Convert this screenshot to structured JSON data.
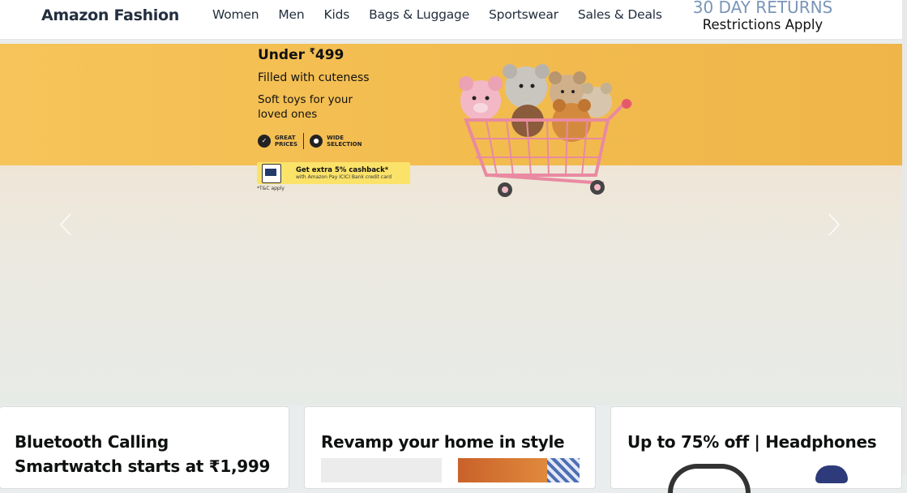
{
  "nav": {
    "brand": "Amazon Fashion",
    "links": [
      "Women",
      "Men",
      "Kids",
      "Bags & Luggage",
      "Sportswear",
      "Sales & Deals"
    ],
    "returns_title": "30 DAY RETURNS",
    "returns_sub": "Restrictions Apply"
  },
  "banner": {
    "price_prefix": "Under ",
    "price_symbol": "₹",
    "price_value": "499",
    "subtitle": "Filled with cuteness",
    "description": "Soft toys for your loved ones",
    "feature_1": [
      "GREAT",
      "PRICES"
    ],
    "feature_2": [
      "WIDE",
      "SELECTION"
    ],
    "cashback_main": "Get extra 5% cashback*",
    "cashback_sub": "with Amazon Pay ICICI Bank credit card",
    "tnc": "*T&C apply",
    "prev_icon": "chevron-left-icon",
    "next_icon": "chevron-right-icon"
  },
  "cards": [
    {
      "title_line1": "Bluetooth Calling",
      "title_line2": "Smartwatch starts at ₹1,999"
    },
    {
      "title_line1": "Revamp your home in style"
    },
    {
      "title_line1": "Up to 75% off | Headphones"
    }
  ],
  "colors": {
    "band": "#f3bd50",
    "cashback": "#fbe36a",
    "nav_text": "#232f3e",
    "returns": "#7a95b8"
  }
}
